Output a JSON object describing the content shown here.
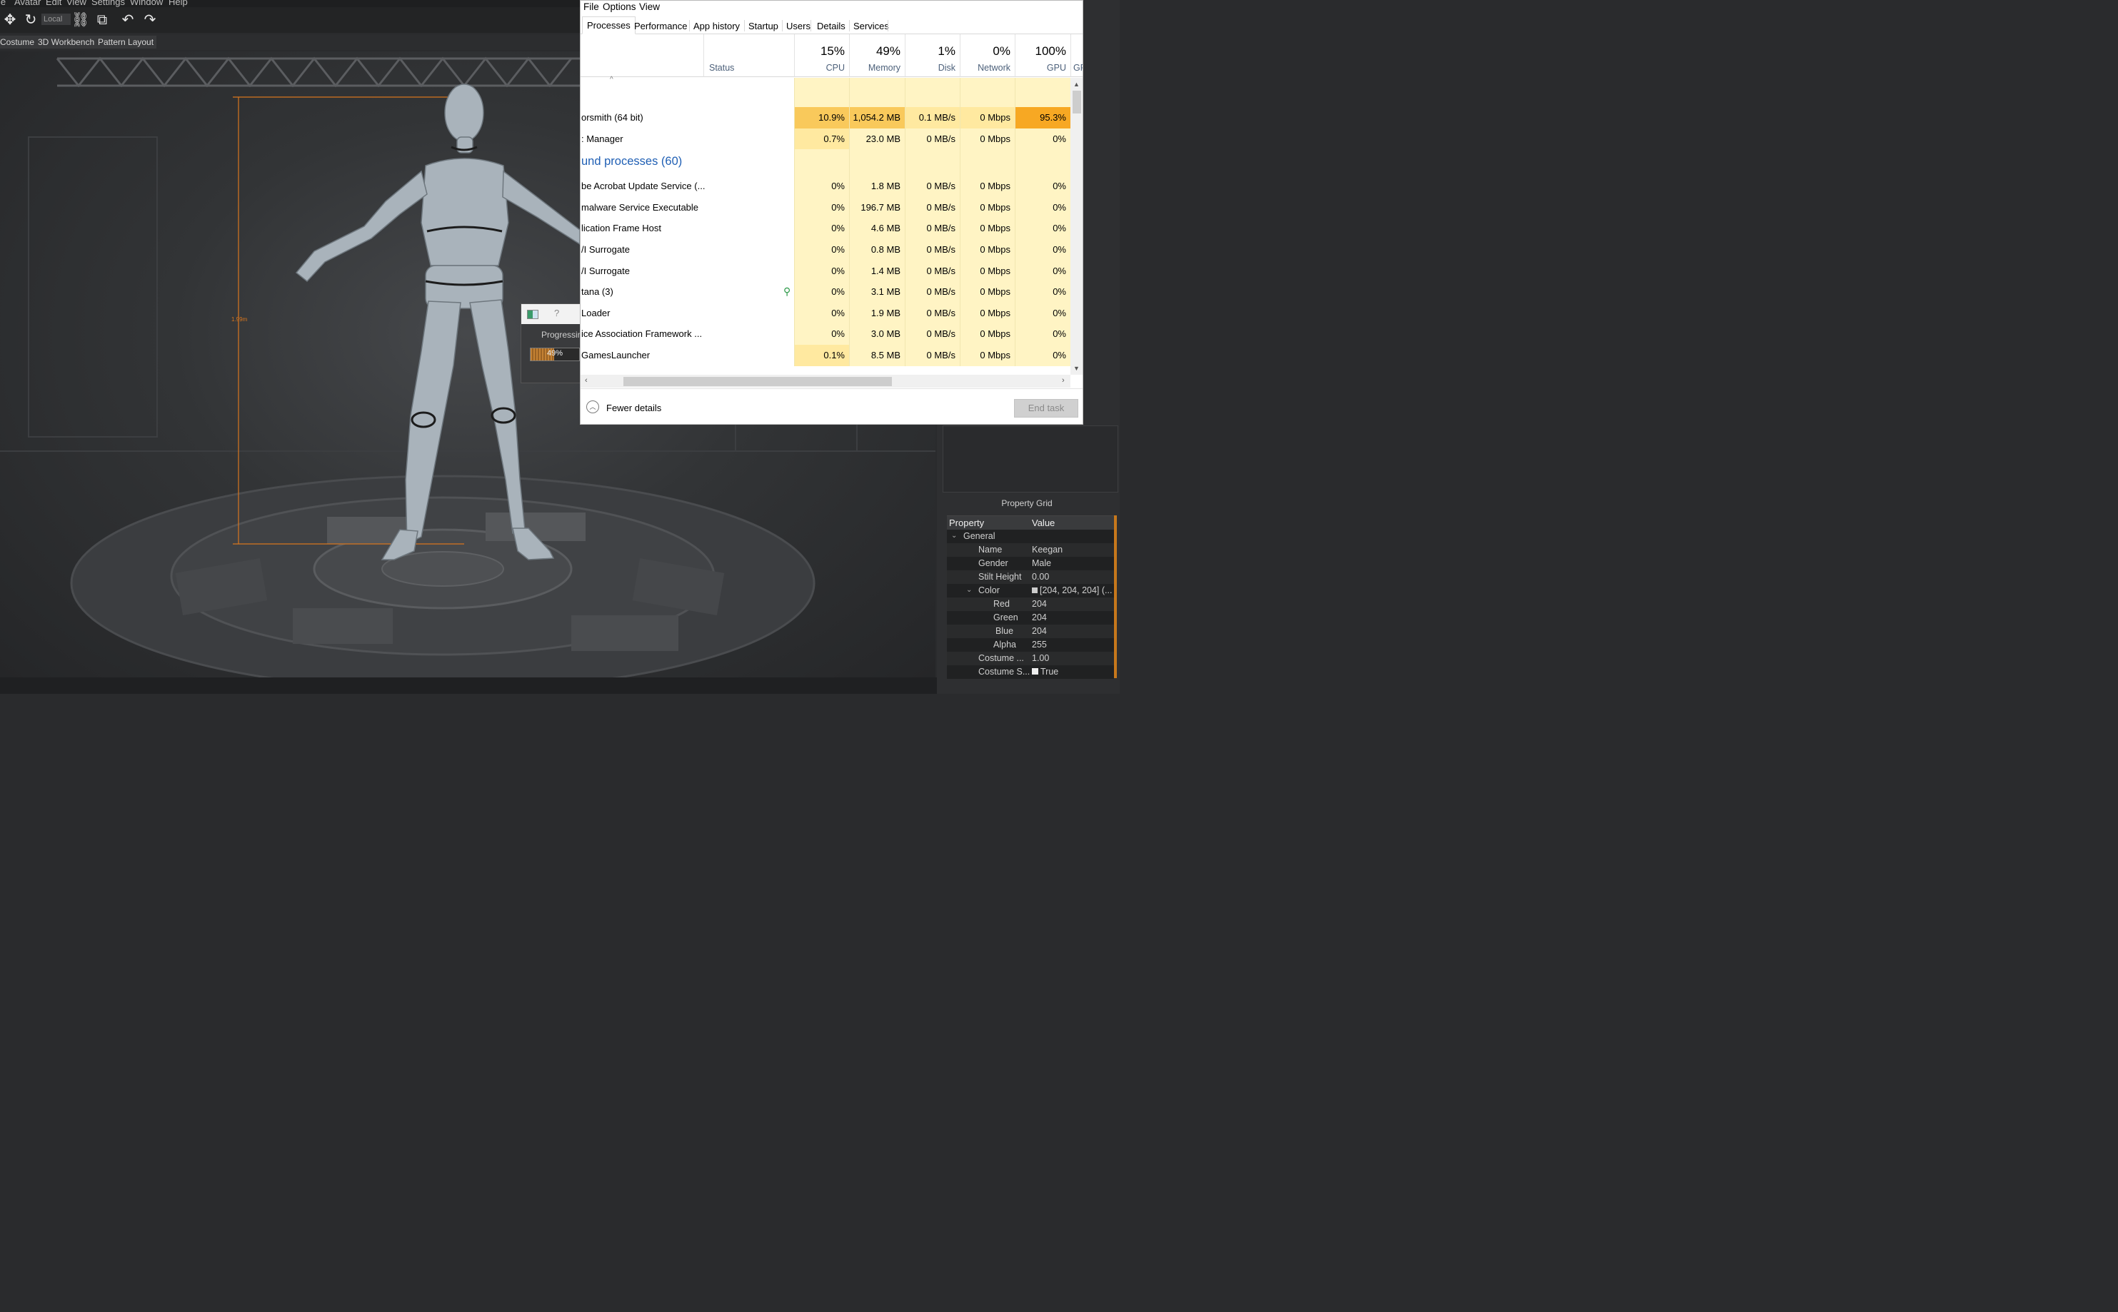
{
  "host": {
    "menu": [
      "le",
      "Avatar",
      "Edit",
      "View",
      "Settings",
      "Window",
      "Help"
    ],
    "toolbar": {
      "local_label": "Local"
    },
    "mode_tabs": [
      "Costume",
      "3D Workbench",
      "Pattern Layout"
    ],
    "viewport": {
      "height_label": "1.99m"
    }
  },
  "progress_dialog": {
    "label": "Progressing",
    "percent_text": "49%",
    "value": 0.49,
    "help_glyph": "?"
  },
  "property_grid": {
    "title": "Property Grid",
    "col_property": "Property",
    "col_value": "Value",
    "group": "General",
    "rows": [
      {
        "key": "Name",
        "value": "Keegan"
      },
      {
        "key": "Gender",
        "value": "Male"
      },
      {
        "key": "Stilt Height",
        "value": "0.00"
      },
      {
        "key": "Color",
        "value": "[204, 204, 204] (..."
      },
      {
        "key": "Red",
        "value": "204"
      },
      {
        "key": "Green",
        "value": "204"
      },
      {
        "key": "Blue",
        "value": "204"
      },
      {
        "key": "Alpha",
        "value": "255"
      },
      {
        "key": "Costume ...",
        "value": "1.00"
      },
      {
        "key": "Costume S...",
        "value": "True"
      }
    ]
  },
  "task_manager": {
    "menu": [
      "File",
      "Options",
      "View"
    ],
    "tabs": [
      "Processes",
      "Performance",
      "App history",
      "Startup",
      "Users",
      "Details",
      "Services"
    ],
    "status_label": "Status",
    "columns": [
      {
        "pct": "15%",
        "label": "CPU"
      },
      {
        "pct": "49%",
        "label": "Memory"
      },
      {
        "pct": "1%",
        "label": "Disk"
      },
      {
        "pct": "0%",
        "label": "Network"
      },
      {
        "pct": "100%",
        "label": "GPU"
      },
      {
        "pct": "",
        "label": "GF"
      }
    ],
    "rows": [
      {
        "name": "",
        "cpu": "",
        "mem": "",
        "disk": "",
        "net": "",
        "gpu": ""
      },
      {
        "name": "orsmith (64 bit)",
        "cpu": "10.9%",
        "mem": "1,054.2 MB",
        "disk": "0.1 MB/s",
        "net": "0 Mbps",
        "gpu": "95.3%",
        "hot": true
      },
      {
        "name": ": Manager",
        "cpu": "0.7%",
        "mem": "23.0 MB",
        "disk": "0 MB/s",
        "net": "0 Mbps",
        "gpu": "0%"
      },
      {
        "group": "und processes (60)"
      },
      {
        "name": "be Acrobat Update Service (...",
        "cpu": "0%",
        "mem": "1.8 MB",
        "disk": "0 MB/s",
        "net": "0 Mbps",
        "gpu": "0%"
      },
      {
        "name": "malware Service Executable",
        "cpu": "0%",
        "mem": "196.7 MB",
        "disk": "0 MB/s",
        "net": "0 Mbps",
        "gpu": "0%"
      },
      {
        "name": "lication Frame Host",
        "cpu": "0%",
        "mem": "4.6 MB",
        "disk": "0 MB/s",
        "net": "0 Mbps",
        "gpu": "0%"
      },
      {
        "name": "/I Surrogate",
        "cpu": "0%",
        "mem": "0.8 MB",
        "disk": "0 MB/s",
        "net": "0 Mbps",
        "gpu": "0%"
      },
      {
        "name": "/I Surrogate",
        "cpu": "0%",
        "mem": "1.4 MB",
        "disk": "0 MB/s",
        "net": "0 Mbps",
        "gpu": "0%"
      },
      {
        "name": "tana (3)",
        "cpu": "0%",
        "mem": "3.1 MB",
        "disk": "0 MB/s",
        "net": "0 Mbps",
        "gpu": "0%",
        "leaf": true
      },
      {
        "name": " Loader",
        "cpu": "0%",
        "mem": "1.9 MB",
        "disk": "0 MB/s",
        "net": "0 Mbps",
        "gpu": "0%"
      },
      {
        "name": "ice Association Framework ...",
        "cpu": "0%",
        "mem": "3.0 MB",
        "disk": "0 MB/s",
        "net": "0 Mbps",
        "gpu": "0%"
      },
      {
        "name": "GamesLauncher",
        "cpu": "0.1%",
        "mem": "8.5 MB",
        "disk": "0 MB/s",
        "net": "0 Mbps",
        "gpu": "0%"
      }
    ],
    "footer": {
      "fewer_details": "Fewer details",
      "end_task": "End task"
    }
  },
  "colors": {
    "heat_light": "#fff4c4",
    "heat_mid": "#ffe9a0",
    "heat_hot": "#f9c95b",
    "heat_gpu_hot": "#f7a823",
    "accent_orange": "#d8761e",
    "group_blue": "#1f5fb4"
  }
}
